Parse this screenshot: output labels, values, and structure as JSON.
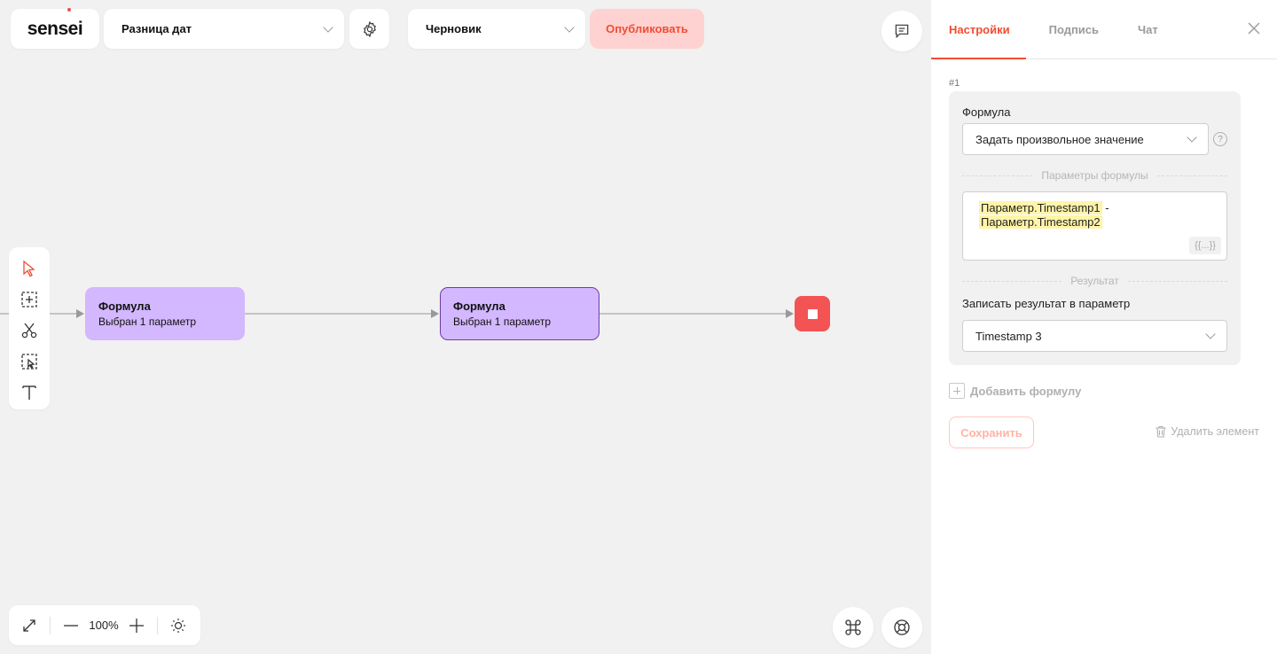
{
  "header": {
    "logo_text": "sensei",
    "process_name": "Разница дат",
    "status": "Черновик",
    "publish_label": "Опубликовать"
  },
  "canvas": {
    "nodes": [
      {
        "title": "Формула",
        "subtitle": "Выбран 1 параметр",
        "selected": false
      },
      {
        "title": "Формула",
        "subtitle": "Выбран 1 параметр",
        "selected": true
      }
    ],
    "zoom": "100%",
    "colors": {
      "node": "#d3b7ff",
      "stop": "#f35353",
      "accent": "#f04d32"
    }
  },
  "panel": {
    "tabs": [
      "Настройки",
      "Подпись",
      "Чат"
    ],
    "active_tab": "Настройки",
    "formula_index": "#1",
    "formula_label": "Формула",
    "formula_type": "Задать произвольное значение",
    "help_glyph": "?",
    "params_divider": "Параметры формулы",
    "expression": {
      "token1": "Параметр.Timestamp1",
      "operator": " - ",
      "token2": "Параметр.Timestamp2"
    },
    "json_button": "{{...}}",
    "result_divider": "Результат",
    "result_label": "Записать результат в параметр",
    "result_param": "Timestamp 3",
    "add_formula": "Добавить формулу",
    "save": "Сохранить",
    "delete": "Удалить элемент"
  },
  "icons": [
    "gear-icon",
    "comments-icon",
    "pointer-icon",
    "add-frame-icon",
    "scissors-icon",
    "select-area-icon",
    "text-icon",
    "fullscreen-icon",
    "minus-icon",
    "plus-icon",
    "brightness-icon",
    "command-icon",
    "lifebuoy-icon",
    "close-icon",
    "trash-icon",
    "chevron-down-icon"
  ]
}
